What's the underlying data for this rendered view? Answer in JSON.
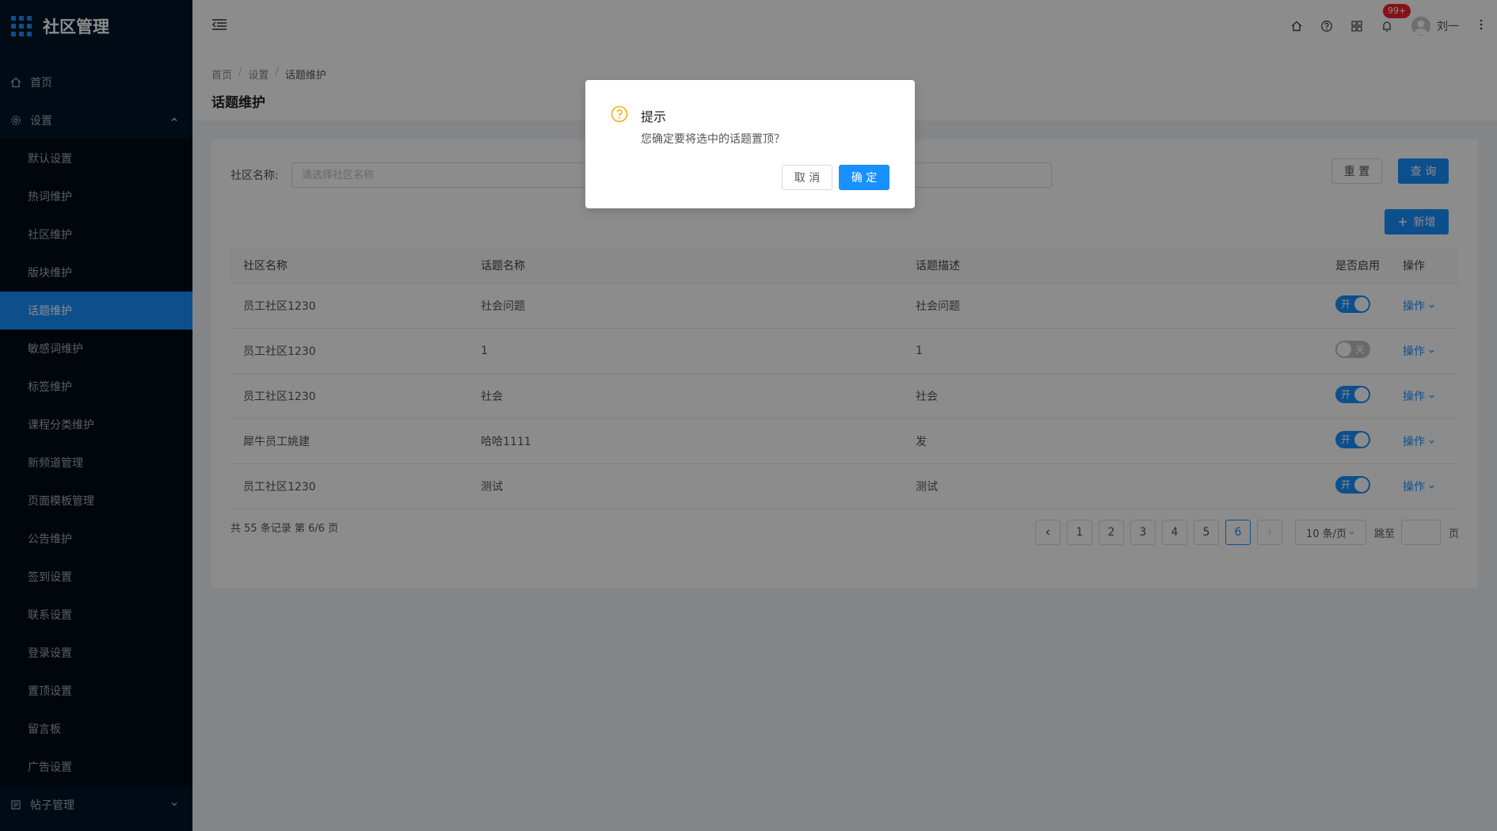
{
  "app": {
    "title": "社区管理"
  },
  "sidebar": {
    "home": "首页",
    "settings": "设置",
    "settings_items": [
      "默认设置",
      "热词维护",
      "社区维护",
      "版块维护",
      "话题维护",
      "敏感词维护",
      "标签维护",
      "课程分类维护",
      "新频道管理",
      "页面模板管理",
      "公告维护",
      "签到设置",
      "联系设置",
      "登录设置",
      "置顶设置",
      "留言板",
      "广告设置"
    ],
    "posts": "帖子管理"
  },
  "header": {
    "badge": "99+",
    "username": "刘一"
  },
  "breadcrumb": [
    "首页",
    "设置",
    "话题维护"
  ],
  "page_title": "话题维护",
  "filter": {
    "label": "社区名称:",
    "placeholder": "请选择社区名称",
    "reset": "重 置",
    "query": "查 询",
    "add": "新增"
  },
  "table": {
    "headers": [
      "社区名称",
      "话题名称",
      "话题描述",
      "是否启用",
      "操作"
    ],
    "rows": [
      {
        "community": "员工社区1230",
        "topic": "社会问题",
        "desc": "社会问题",
        "enabled": true
      },
      {
        "community": "员工社区1230",
        "topic": "1",
        "desc": "1",
        "enabled": false
      },
      {
        "community": "员工社区1230",
        "topic": "社会",
        "desc": "社会",
        "enabled": true
      },
      {
        "community": "犀牛员工姚建",
        "topic": "哈哈1111",
        "desc": "发",
        "enabled": true
      },
      {
        "community": "员工社区1230",
        "topic": "测试",
        "desc": "测试",
        "enabled": true
      }
    ],
    "switch_on": "开",
    "switch_off": "关",
    "op_label": "操作"
  },
  "pagination": {
    "total": "共 55 条记录 第 6/6 页",
    "pages": [
      "1",
      "2",
      "3",
      "4",
      "5",
      "6"
    ],
    "current": "6",
    "page_size": "10 条/页",
    "jump_label": "跳至",
    "page_suffix": "页"
  },
  "modal": {
    "title": "提示",
    "content": "您确定要将选中的话题置顶？",
    "cancel": "取 消",
    "ok": "确 定"
  },
  "colors": {
    "primary": "#1890ff",
    "sidebar": "#001529",
    "warning": "#faad14",
    "badge": "#f5222d"
  }
}
